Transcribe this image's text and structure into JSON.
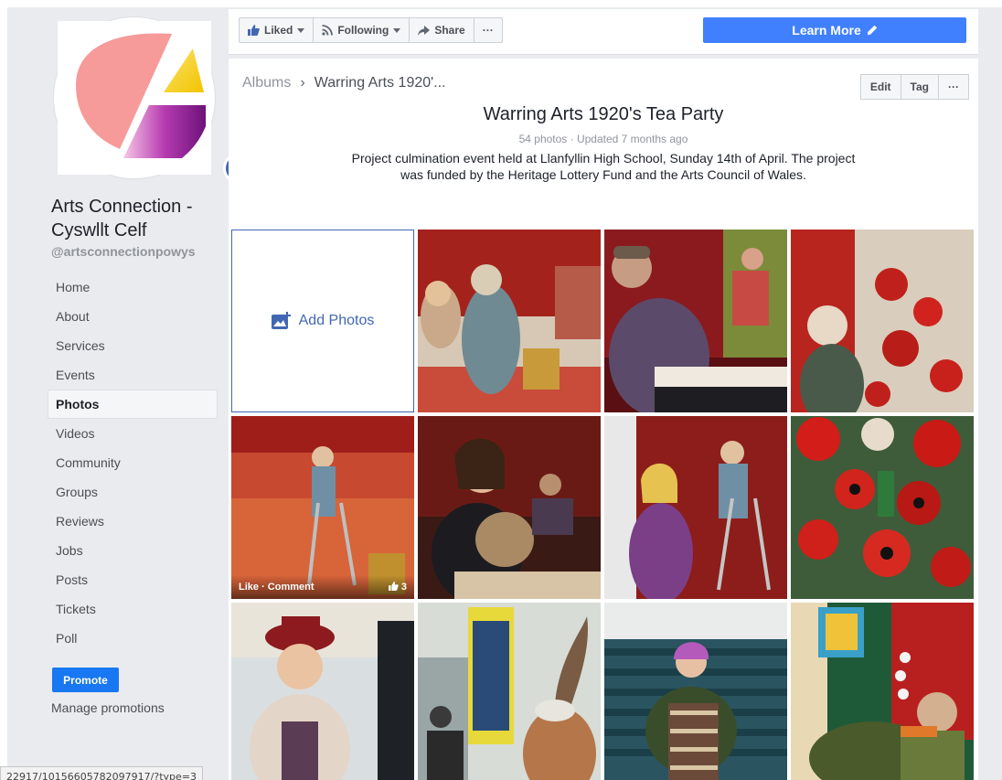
{
  "page": {
    "name": "Arts Connection - Cyswllt Celf",
    "handle": "@artsconnectionpowys",
    "avatar_icon": "arts-connection-logo",
    "colors": {
      "pink": "#f4999a",
      "yellow": "#f7d21d",
      "purple": "#8a1b8a",
      "blue": "#4267b2",
      "accent": "#4080ff"
    }
  },
  "nav": {
    "items": [
      {
        "label": "Home"
      },
      {
        "label": "About"
      },
      {
        "label": "Services"
      },
      {
        "label": "Events"
      },
      {
        "label": "Photos",
        "active": true
      },
      {
        "label": "Videos"
      },
      {
        "label": "Community"
      },
      {
        "label": "Groups"
      },
      {
        "label": "Reviews"
      },
      {
        "label": "Jobs"
      },
      {
        "label": "Posts"
      },
      {
        "label": "Tickets"
      },
      {
        "label": "Poll"
      }
    ],
    "promote_label": "Promote",
    "manage_promotions_label": "Manage promotions"
  },
  "actions": {
    "liked_label": "Liked",
    "following_label": "Following",
    "share_label": "Share",
    "more_label": "···",
    "learn_more_label": "Learn More"
  },
  "album": {
    "breadcrumb_root": "Albums",
    "breadcrumb_sep": "›",
    "breadcrumb_current": "Warring Arts 1920'...",
    "edit_label": "Edit",
    "tag_label": "Tag",
    "more_label": "···",
    "title": "Warring Arts 1920's Tea Party",
    "meta": "54 photos · Updated 7 months ago",
    "description": "Project culmination event held at Llanfyllin High School, Sunday 14th of April. The project was funded by the Heritage Lottery Fund and the Arts Council of Wales.",
    "add_photos_label": "Add Photos",
    "hover_overlay": {
      "actions": "Like · Comment",
      "like_count": "3"
    }
  },
  "status_bar": {
    "url": "22917/10156605782097917/?type=3"
  }
}
